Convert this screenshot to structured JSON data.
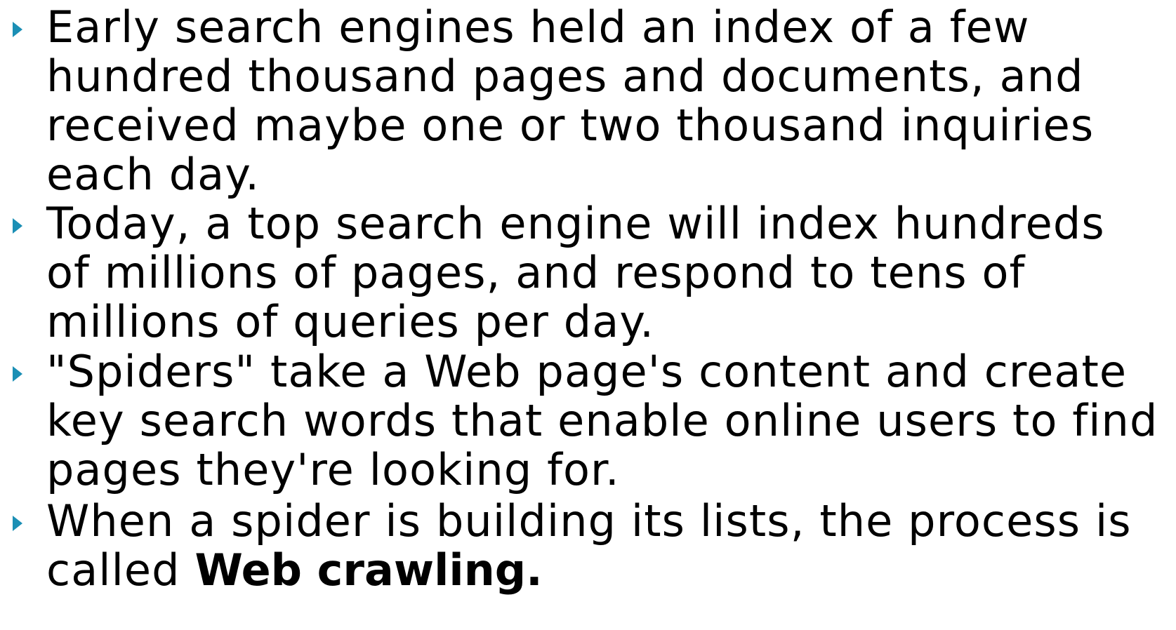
{
  "accent_color": "#1b8fb5",
  "bullet_icon": "triangle-right-icon",
  "bullets": [
    {
      "lines": [
        "Early search engines held an index of a few",
        "hundred thousand pages and documents, and",
        "received maybe one or two thousand inquiries",
        "each day."
      ]
    },
    {
      "lines": [
        "Today, a top search engine will index hundreds",
        "of millions of pages, and respond to tens of",
        "millions of queries per day."
      ]
    },
    {
      "lines": [
        "\"Spiders\" take a Web page's content and create",
        "key search words that enable online users to find",
        "pages they're looking for."
      ]
    },
    {
      "lines": [
        "When a spider is building its lists, the process is",
        "called "
      ],
      "emphasis": "Web crawling."
    }
  ]
}
